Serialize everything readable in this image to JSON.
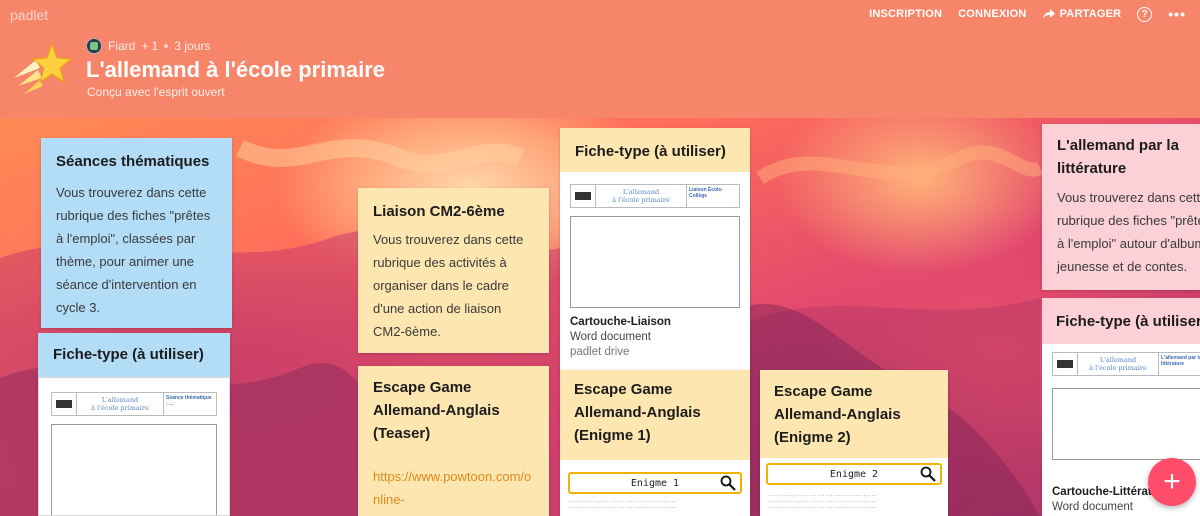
{
  "brand": "padlet",
  "nav": {
    "inscription": "INSCRIPTION",
    "connexion": "CONNEXION",
    "partager": "PARTAGER",
    "help": "?",
    "more": "•••"
  },
  "author": {
    "name": "Fiard",
    "plus": "+ 1",
    "time": "3 jours"
  },
  "title": "L'allemand à l'école primaire",
  "subtitle": "Conçu avec l'esprit ouvert",
  "colors": {
    "header": "#f78569",
    "card_blue": "#b3dcf7",
    "card_yellow": "#fde6b0",
    "card_pink": "#fbd0d6",
    "fab": "#ff4c6a",
    "link": "#e08a1e"
  },
  "col1": {
    "card1": {
      "title": "Séances thématiques",
      "body": "Vous trouverez dans cette rubrique des fiches \"prêtes à l'emploi\", classées par thème, pour animer une séance d'intervention en cycle 3."
    },
    "card2": {
      "title": "Fiche-type (à utiliser)",
      "doc_l1": "L'allemand",
      "doc_l2": "à l'école primaire",
      "doc_c3": "Séance thématique : ..."
    }
  },
  "col2": {
    "card1": {
      "title": "Liaison CM2-6ème",
      "body": "Vous trouverez dans cette rubrique des activités à organiser dans le cadre d'une action de liaison CM2-6ème."
    },
    "card2": {
      "title": "Escape Game Allemand-Anglais (Teaser)",
      "link": "https://www.powtoon.com/online-"
    }
  },
  "col3": {
    "card1": {
      "title": "Fiche-type (à utiliser)",
      "doc_l1": "L'allemand",
      "doc_l2": "à l'école primaire",
      "doc_c3": "Liaison École-Collège",
      "attach_title": "Cartouche-Liaison",
      "attach_type": "Word document",
      "attach_src": "padlet drive"
    },
    "card2": {
      "title": "Escape Game Allemand-Anglais (Enigme 1)",
      "enigme": "Enigme 1"
    }
  },
  "col4": {
    "card1": {
      "title": "Escape Game Allemand-Anglais (Enigme 2)",
      "enigme": "Enigme 2"
    }
  },
  "col5": {
    "card1": {
      "title": "L'allemand par la littérature",
      "body": "Vous trouverez dans cette rubrique des fiches \"prêtes à l'emploi\" autour d'albums jeunesse et de contes."
    },
    "card2": {
      "title": "Fiche-type (à utiliser)",
      "doc_l1": "L'allemand",
      "doc_l2": "à l'école primaire",
      "doc_c3": "L'allemand par la littérature",
      "attach_title": "Cartouche-Littérature",
      "attach_type": "Word document"
    }
  },
  "fab": "+",
  "icons": [
    "star-logo-icon",
    "share-icon",
    "help-icon",
    "more-icon",
    "magnifier-icon",
    "plus-icon"
  ]
}
